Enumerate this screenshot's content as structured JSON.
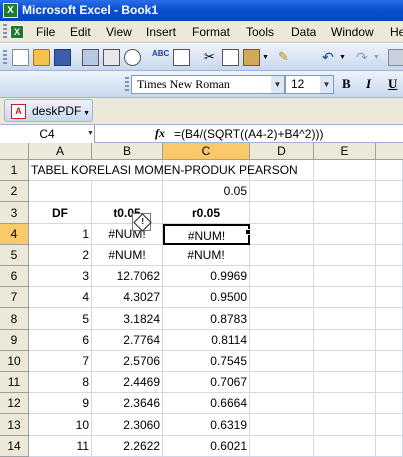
{
  "window": {
    "title": "Microsoft Excel - Book1"
  },
  "menu": [
    "File",
    "Edit",
    "View",
    "Insert",
    "Format",
    "Tools",
    "Data",
    "Window",
    "He"
  ],
  "format_toolbar": {
    "font_name": "Times New Roman",
    "font_size": "12",
    "bold": "B",
    "italic": "I",
    "underline": "U"
  },
  "pdf_toolbar": {
    "label": "deskPDF"
  },
  "formula_bar": {
    "name_box": "C4",
    "fx": "fx",
    "formula": "=(B4/(SQRT((A4-2)+B4^2)))"
  },
  "columns": [
    "A",
    "B",
    "C",
    "D",
    "E"
  ],
  "active_cell": {
    "column": "C",
    "row": 4
  },
  "rows": [
    {
      "n": "1",
      "title": "TABEL KORELASI MOMEN-PRODUK PEARSON"
    },
    {
      "n": "2",
      "C": "0.05"
    },
    {
      "n": "3",
      "A": "DF",
      "B": "t0.05",
      "C": "r0.05"
    },
    {
      "n": "4",
      "A": "1",
      "B": "#NUM!",
      "C": "#NUM!"
    },
    {
      "n": "5",
      "A": "2",
      "B": "#NUM!",
      "C": "#NUM!"
    },
    {
      "n": "6",
      "A": "3",
      "B": "12.7062",
      "C": "0.9969"
    },
    {
      "n": "7",
      "A": "4",
      "B": "4.3027",
      "C": "0.9500"
    },
    {
      "n": "8",
      "A": "5",
      "B": "3.1824",
      "C": "0.8783"
    },
    {
      "n": "9",
      "A": "6",
      "B": "2.7764",
      "C": "0.8114"
    },
    {
      "n": "10",
      "A": "7",
      "B": "2.5706",
      "C": "0.7545"
    },
    {
      "n": "11",
      "A": "8",
      "B": "2.4469",
      "C": "0.7067"
    },
    {
      "n": "12",
      "A": "9",
      "B": "2.3646",
      "C": "0.6664"
    },
    {
      "n": "13",
      "A": "10",
      "B": "2.3060",
      "C": "0.6319"
    },
    {
      "n": "14",
      "A": "11",
      "B": "2.2622",
      "C": "0.6021"
    }
  ]
}
